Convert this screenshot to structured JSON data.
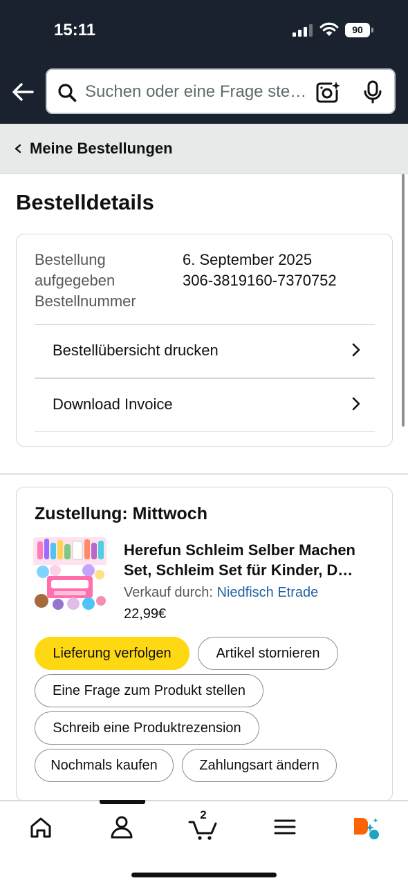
{
  "status_bar": {
    "time": "15:11",
    "battery": "90"
  },
  "search": {
    "placeholder": "Suchen oder eine Frage stellen"
  },
  "breadcrumb": {
    "label": "Meine Bestellungen"
  },
  "page": {
    "title": "Bestelldetails"
  },
  "order": {
    "placed_label": "Bestellung aufgegeben",
    "number_label": "Bestellnummer",
    "placed_date": "6. September 2025",
    "number": "306-3819160-7370752",
    "links": [
      "Bestellübersicht drucken",
      "Download Invoice"
    ]
  },
  "shipment": {
    "title": "Zustellung: Mittwoch",
    "product_title": "Herefun Schleim Selber Machen Set, Schleim Set für Kinder, D…",
    "seller_prefix": "Verkauf durch:",
    "seller_name": "Niedfisch Etrade",
    "price": "22,99€",
    "actions": {
      "track": "Lieferung verfolgen",
      "cancel": "Artikel stornieren",
      "question": "Eine Frage zum Produkt stellen",
      "review": "Schreib eine Produktrezension",
      "buy_again": "Nochmals kaufen",
      "payment": "Zahlungsart ändern"
    }
  },
  "tabbar": {
    "cart_count": "2"
  },
  "icons": {
    "back": "arrow-left-icon",
    "search": "search-icon",
    "camera": "camera-lens-icon",
    "mic": "microphone-icon",
    "home": "home-icon",
    "account": "person-icon",
    "cart": "cart-icon",
    "menu": "menu-icon",
    "rufus": "rufus-assistant-icon"
  },
  "colors": {
    "header_bg": "#1a2230",
    "primary_button": "#ffd814",
    "link": "#2162a1",
    "rufus_orange": "#ff6200",
    "rufus_teal": "#1ea4c1"
  }
}
